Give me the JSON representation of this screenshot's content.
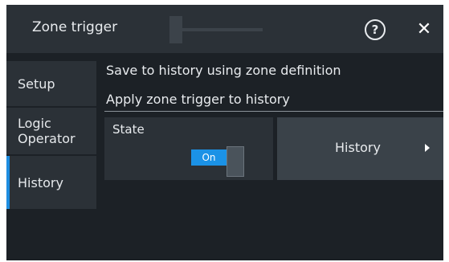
{
  "dialog": {
    "title": "Zone trigger",
    "help_icon": "?",
    "close_icon": "✕"
  },
  "sidebar": {
    "items": [
      {
        "label": "Setup"
      },
      {
        "label": "Logic\nOperator"
      },
      {
        "label": "History",
        "active": true
      }
    ]
  },
  "content": {
    "line1": "Save to history using zone definition",
    "line2": "Apply zone trigger to history",
    "state": {
      "label": "State",
      "toggle_value": "On"
    },
    "history_button": {
      "label": "History",
      "icon": "chevron-right-icon"
    }
  },
  "colors": {
    "accent": "#1b92e6",
    "background": "#1c2126",
    "panel": "#2b3137"
  }
}
